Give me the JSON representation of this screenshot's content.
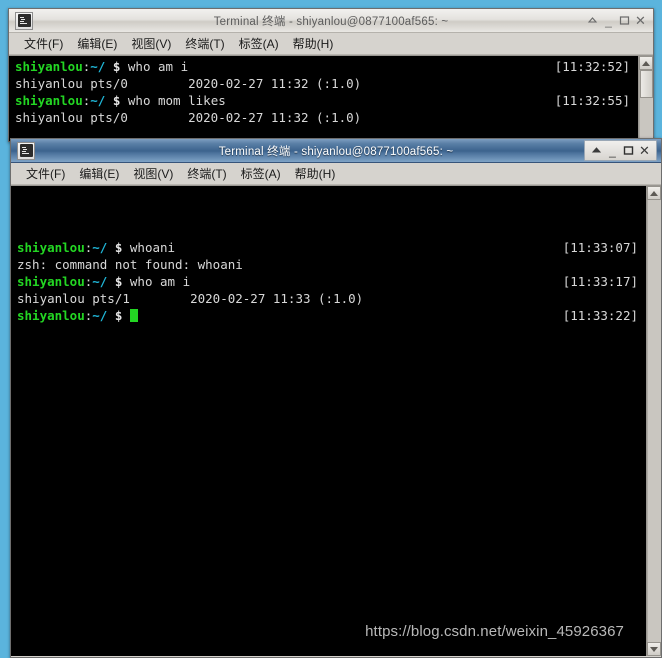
{
  "desktop": {
    "background_color": "#5bb4dd"
  },
  "watermark": {
    "text": "https://blog.csdn.net/weixin_45926367"
  },
  "menu": {
    "items": [
      {
        "name": "file",
        "label": "文件(F)",
        "pre": "文件(",
        "key": "F",
        "post": ")"
      },
      {
        "name": "edit",
        "label": "编辑(E)",
        "pre": "编辑(",
        "key": "E",
        "post": ")"
      },
      {
        "name": "view",
        "label": "视图(V)",
        "pre": "视图(",
        "key": "V",
        "post": ")"
      },
      {
        "name": "terminal",
        "label": "终端(T)",
        "pre": "终端(",
        "key": "T",
        "post": ")"
      },
      {
        "name": "tabs",
        "label": "标签(A)",
        "pre": "标签(",
        "key": "A",
        "post": ")"
      },
      {
        "name": "help",
        "label": "帮助(H)",
        "pre": "帮助(",
        "key": "H",
        "post": ")"
      }
    ]
  },
  "window_buttons": {
    "shade": "shade-icon",
    "minimize": "minimize-icon",
    "maximize": "maximize-icon",
    "close": "close-icon",
    "minimize_label": "_",
    "close_label": "✕"
  },
  "window1": {
    "title": "Terminal 终端 - shiyanlou@0877100af565: ~",
    "state": "inactive",
    "icon": "terminal-icon",
    "lines": [
      {
        "type": "prompt",
        "user": "shiyanlou",
        "colon": ":",
        "path": "~/",
        "sign": " $ ",
        "command": "who am i",
        "timestamp": "[11:32:52]"
      },
      {
        "type": "output",
        "text": "shiyanlou pts/0        2020-02-27 11:32 (:1.0)",
        "timestamp": ""
      },
      {
        "type": "prompt",
        "user": "shiyanlou",
        "colon": ":",
        "path": "~/",
        "sign": " $ ",
        "command": "who mom likes",
        "timestamp": "[11:32:55]"
      },
      {
        "type": "output",
        "text": "shiyanlou pts/0        2020-02-27 11:32 (:1.0)",
        "timestamp": ""
      }
    ]
  },
  "window2": {
    "title": "Terminal 终端 - shiyanlou@0877100af565: ~",
    "state": "active",
    "icon": "terminal-icon",
    "lines": [
      {
        "type": "prompt",
        "user": "shiyanlou",
        "colon": ":",
        "path": "~/",
        "sign": " $ ",
        "command": "whoani",
        "timestamp": "[11:33:07]"
      },
      {
        "type": "output",
        "text": "zsh: command not found: whoani",
        "timestamp": ""
      },
      {
        "type": "prompt",
        "user": "shiyanlou",
        "colon": ":",
        "path": "~/",
        "sign": " $ ",
        "command": "who am i",
        "timestamp": "[11:33:17]"
      },
      {
        "type": "output",
        "text": "shiyanlou pts/1        2020-02-27 11:33 (:1.0)",
        "timestamp": ""
      },
      {
        "type": "prompt-cursor",
        "user": "shiyanlou",
        "colon": ":",
        "path": "~/",
        "sign": " $ ",
        "command": "",
        "timestamp": "[11:33:22]"
      }
    ]
  },
  "colors": {
    "prompt_user": "#23d623",
    "prompt_path": "#1fb5d6",
    "terminal_bg": "#000000",
    "terminal_fg": "#d8d8d8",
    "titlebar_active": "#3c638d",
    "titlebar_inactive": "#e4e2de",
    "chrome": "#d6d3ce"
  }
}
